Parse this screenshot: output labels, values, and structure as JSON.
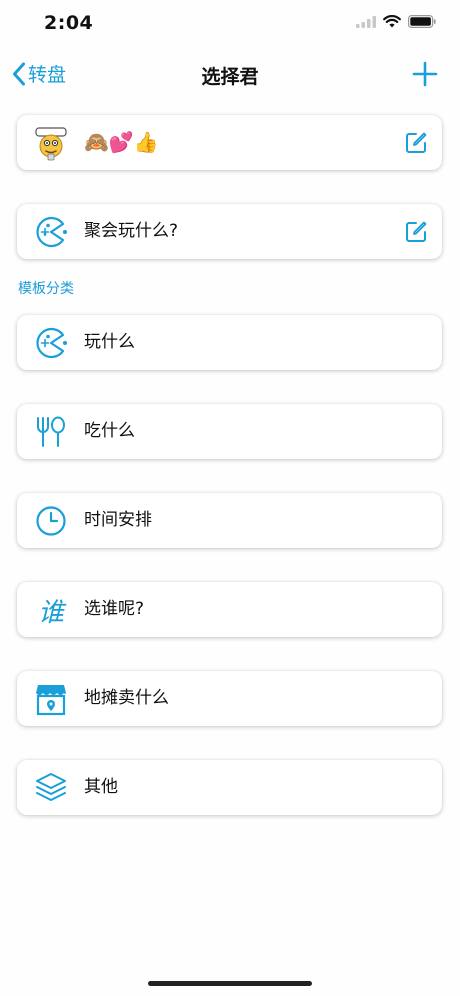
{
  "status": {
    "time": "2:04"
  },
  "nav": {
    "back_label": "转盘",
    "title": "选择君"
  },
  "cards": {
    "user": {
      "label": "🙈💕👍"
    },
    "current": {
      "label": "聚会玩什么?"
    }
  },
  "section": {
    "title": "模板分类"
  },
  "templates": [
    {
      "label": "玩什么",
      "icon": "pacman-icon"
    },
    {
      "label": "吃什么",
      "icon": "fork-spoon-icon"
    },
    {
      "label": "时间安排",
      "icon": "clock-icon"
    },
    {
      "label": "选谁呢?",
      "icon": "who-char-icon",
      "glyph": "谁"
    },
    {
      "label": "地摊卖什么",
      "icon": "stall-icon"
    },
    {
      "label": "其他",
      "icon": "layers-icon"
    }
  ],
  "colors": {
    "accent": "#1a9fd8",
    "text": "#111111",
    "background": "#fefefe"
  }
}
